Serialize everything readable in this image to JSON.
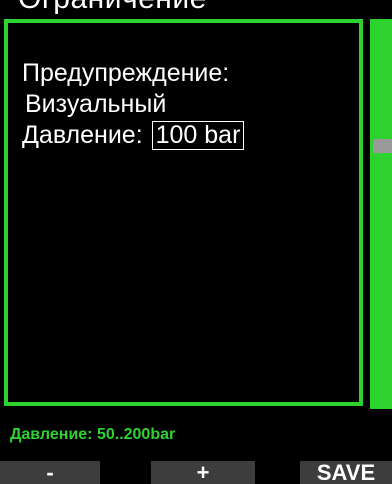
{
  "screen": {
    "title_partial": "Ограничение"
  },
  "settings": {
    "warning_label": "Предупреждение:",
    "warning_value": "Визуальный",
    "pressure_label": "Давление:",
    "pressure_value": "100 bar"
  },
  "hint": {
    "text": "Давление: 50..200bar"
  },
  "softkeys": {
    "minus": "-",
    "plus": "+",
    "save": "SAVE"
  },
  "colors": {
    "accent": "#2ed22e",
    "background": "#000000",
    "softkey_bg": "#3d3d3d",
    "scroll_thumb": "#9a9a9a"
  }
}
